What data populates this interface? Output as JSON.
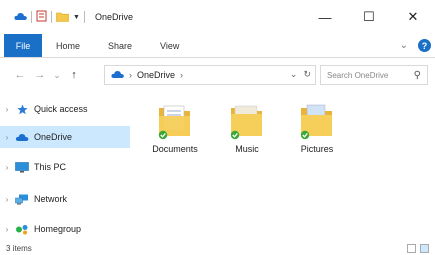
{
  "window": {
    "title": "OneDrive",
    "minimize_glyph": "—",
    "maximize_glyph": "☐",
    "close_glyph": "✕"
  },
  "ribbon": {
    "tabs": [
      {
        "label": "File"
      },
      {
        "label": "Home"
      },
      {
        "label": "Share"
      },
      {
        "label": "View"
      }
    ],
    "expand_glyph": "⌄",
    "help_glyph": "?"
  },
  "nav": {
    "back": "←",
    "forward": "→",
    "recent": "⌄",
    "up": "↑",
    "breadcrumb": [
      "OneDrive"
    ],
    "dropdown_glyph": "⌄",
    "refresh_glyph": "↻",
    "search_placeholder": "Search OneDrive",
    "search_glyph": "⚲"
  },
  "sidebar": {
    "items": [
      {
        "label": "Quick access",
        "icon": "star-icon",
        "color": "#2a7bd4",
        "selected": false
      },
      {
        "label": "OneDrive",
        "icon": "cloud-icon",
        "color": "#1d6fcf",
        "selected": true
      },
      {
        "label": "This PC",
        "icon": "monitor-icon",
        "color": "#2a8fd8",
        "selected": false
      },
      {
        "label": "Network",
        "icon": "network-icon",
        "color": "#2a8fd8",
        "selected": false
      },
      {
        "label": "Homegroup",
        "icon": "homegroup-icon",
        "color": "#2a8fd8",
        "selected": false
      }
    ]
  },
  "files": [
    {
      "name": "Documents",
      "icon": "documents-folder-icon"
    },
    {
      "name": "Music",
      "icon": "music-folder-icon"
    },
    {
      "name": "Pictures",
      "icon": "pictures-folder-icon"
    }
  ],
  "status": {
    "item_count": "3 items"
  },
  "colors": {
    "accent": "#1a6fc7",
    "selected_bg": "#cce8ff",
    "folder": "#f3c84b",
    "sync_ok": "#3aa835"
  }
}
